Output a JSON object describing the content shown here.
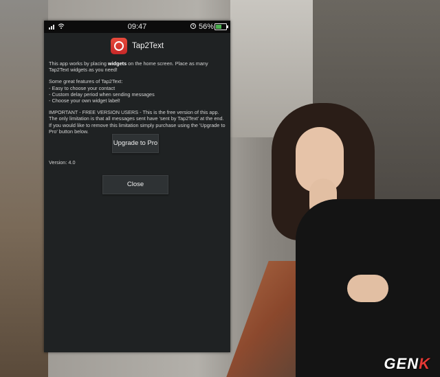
{
  "status_bar": {
    "time": "09:47",
    "battery_percent": "56%",
    "battery_level": 0.56,
    "icons": [
      "signal-icon",
      "wifi-icon",
      "alarm-icon",
      "battery-icon"
    ]
  },
  "app": {
    "title": "Tap2Text",
    "icon": "tap2text-app-icon"
  },
  "content": {
    "intro_pre": "This app works by placing ",
    "intro_bold": "widgets",
    "intro_post": " on the home screen. Place as many Tap2Text widgets as you need!",
    "features_heading": "Some great features of Tap2Text:",
    "features": [
      "- Easy to choose your contact",
      "- Custom delay period when sending messages",
      "- Choose your own widget label!"
    ],
    "important": "IMPORTANT - FREE VERSION USERS - This is the free version of this app. The only limitation is that all messages sent have 'sent by Tap2Text' at the end. If you would like to remove this limitation simply purchase using the 'Upgrade to Pro' button below."
  },
  "buttons": {
    "upgrade_label": "Upgrade to Pro",
    "close_label": "Close"
  },
  "version": "Version: 4.0",
  "watermark": {
    "text_main": "GEN",
    "text_accent": "K"
  },
  "colors": {
    "screen_bg": "#1f2223",
    "button_bg": "#2e3234",
    "battery_fill": "#4caf50",
    "icon_red": "#e84b3c"
  }
}
